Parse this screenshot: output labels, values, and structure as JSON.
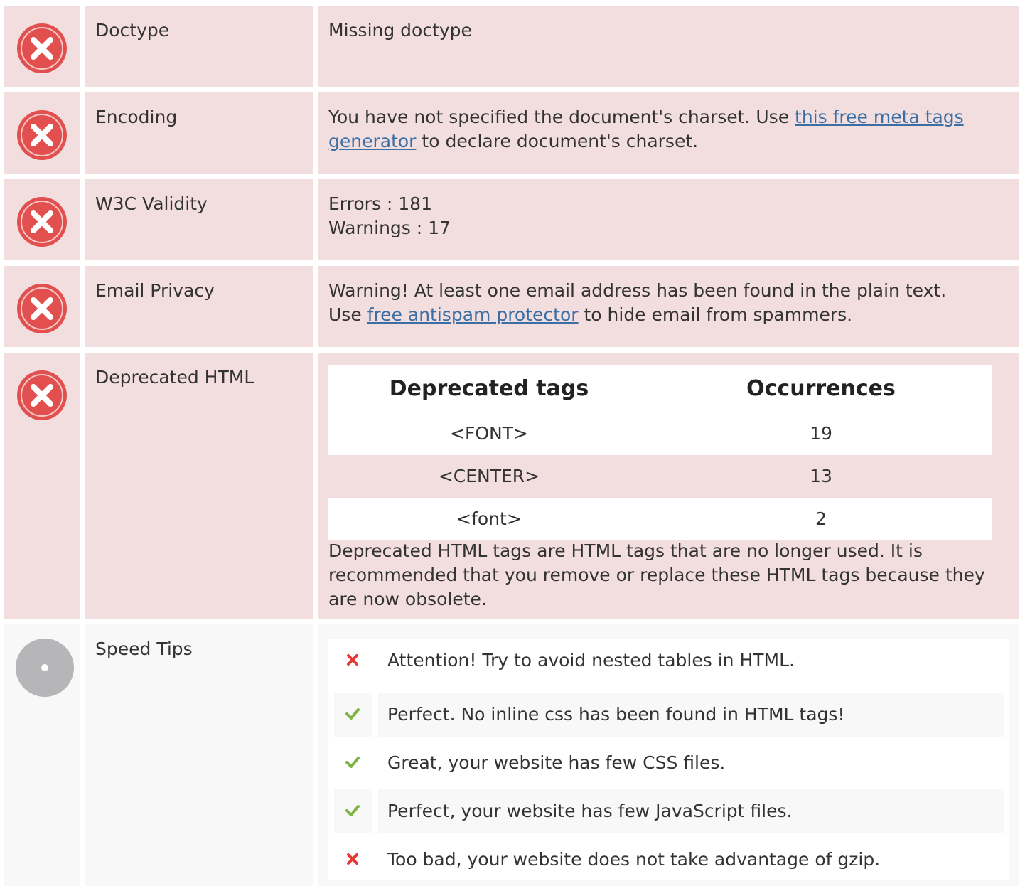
{
  "colors": {
    "error_row_bg": "#f2dedf",
    "neutral_row_bg": "#f8f8f8",
    "error_icon": "#e24f4f",
    "neutral_icon": "#b6b6b8",
    "link": "#3a6fa6",
    "check": "#7cb342",
    "cross": "#e53935"
  },
  "rows": {
    "doctype": {
      "status": "error",
      "label": "Doctype",
      "value": "Missing doctype"
    },
    "encoding": {
      "status": "error",
      "label": "Encoding",
      "text_before": "You have not specified the document's charset. Use ",
      "link": "this free meta tags generator",
      "text_after": " to declare document's charset."
    },
    "w3c": {
      "status": "error",
      "label": "W3C Validity",
      "errors": "Errors : 181",
      "warnings": "Warnings : 17"
    },
    "email": {
      "status": "error",
      "label": "Email Privacy",
      "warning": "Warning! At least one email address has been found in the plain text.",
      "text_before": "Use ",
      "link": "free antispam protector",
      "text_after": " to hide email from spammers."
    },
    "deprecated": {
      "status": "error",
      "label": "Deprecated HTML",
      "table": {
        "headers": [
          "Deprecated tags",
          "Occurrences"
        ],
        "rows": [
          {
            "tag": "<FONT>",
            "count": "19"
          },
          {
            "tag": "<CENTER>",
            "count": "13"
          },
          {
            "tag": "<font>",
            "count": "2"
          }
        ]
      },
      "note": "Deprecated HTML tags are HTML tags that are no longer used. It is recommended that you remove or replace these HTML tags because they are now obsolete."
    },
    "speed": {
      "status": "neutral",
      "label": "Speed Tips",
      "tips": [
        {
          "mark": "cross-icon",
          "text": "Attention! Try to avoid nested tables in HTML."
        },
        {
          "mark": "check-icon",
          "text": "Perfect. No inline css has been found in HTML tags!"
        },
        {
          "mark": "check-icon",
          "text": "Great, your website has few CSS files."
        },
        {
          "mark": "check-icon",
          "text": "Perfect, your website has few JavaScript files."
        },
        {
          "mark": "cross-icon",
          "text": "Too bad, your website does not take advantage of gzip."
        }
      ]
    }
  }
}
